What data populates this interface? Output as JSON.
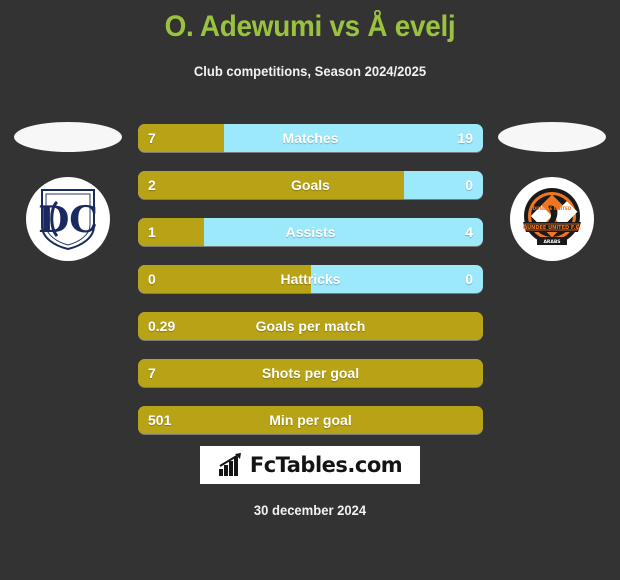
{
  "header": {
    "title": "O. Adewumi vs Å evelj",
    "subtitle": "Club competitions, Season 2024/2025"
  },
  "teams": {
    "home": {
      "crest_name": "dundee-fc-crest",
      "monogram": "DFC"
    },
    "away": {
      "crest_name": "dundee-united-fc-crest",
      "monogram": "DUFC"
    }
  },
  "footer": {
    "logo_text": "FcTables.com",
    "logo_icon": "bar-chart-icon",
    "date": "30 december 2024"
  },
  "colors": {
    "background": "#333333",
    "title": "#9ac23f",
    "home_bar": "#b8a316",
    "away_bar": "#9be9fb",
    "value_text": "#ffffff"
  },
  "chart_data": {
    "type": "bar",
    "title": "O. Adewumi vs Å evelj",
    "subtitle": "Club competitions, Season 2024/2025",
    "orientation": "horizontal-diverging",
    "series": [
      {
        "name": "O. Adewumi",
        "color": "#b8a316"
      },
      {
        "name": "Å evelj",
        "color": "#9be9fb"
      }
    ],
    "categories": [
      "Matches",
      "Goals",
      "Assists",
      "Hattricks",
      "Goals per match",
      "Shots per goal",
      "Min per goal"
    ],
    "rows": [
      {
        "label": "Matches",
        "home": "7",
        "away": "19",
        "home_pct": 25,
        "dual": true
      },
      {
        "label": "Goals",
        "home": "2",
        "away": "0",
        "home_pct": 77,
        "dual": true
      },
      {
        "label": "Assists",
        "home": "1",
        "away": "4",
        "home_pct": 19,
        "dual": true
      },
      {
        "label": "Hattricks",
        "home": "0",
        "away": "0",
        "home_pct": 50,
        "dual": true
      },
      {
        "label": "Goals per match",
        "home": "0.29",
        "away": "",
        "home_pct": 100,
        "dual": false
      },
      {
        "label": "Shots per goal",
        "home": "7",
        "away": "",
        "home_pct": 100,
        "dual": false
      },
      {
        "label": "Min per goal",
        "home": "501",
        "away": "",
        "home_pct": 100,
        "dual": false
      }
    ],
    "grid": false,
    "legend": "none"
  }
}
